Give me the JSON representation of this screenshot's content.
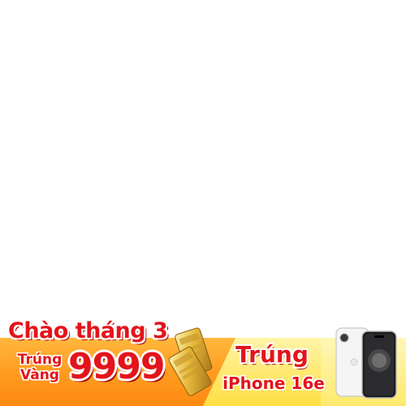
{
  "promo": {
    "headline": "Chào tháng 3",
    "win_label_line1": "Trúng",
    "win_label_line2": "Vàng",
    "gold_amount": "9999",
    "prize_title": "Trúng",
    "prize_model": "iPhone 16e"
  },
  "colors": {
    "accent_red": "#e3141b",
    "orange": "#ff9a1f",
    "yellow": "#ffe76a"
  }
}
